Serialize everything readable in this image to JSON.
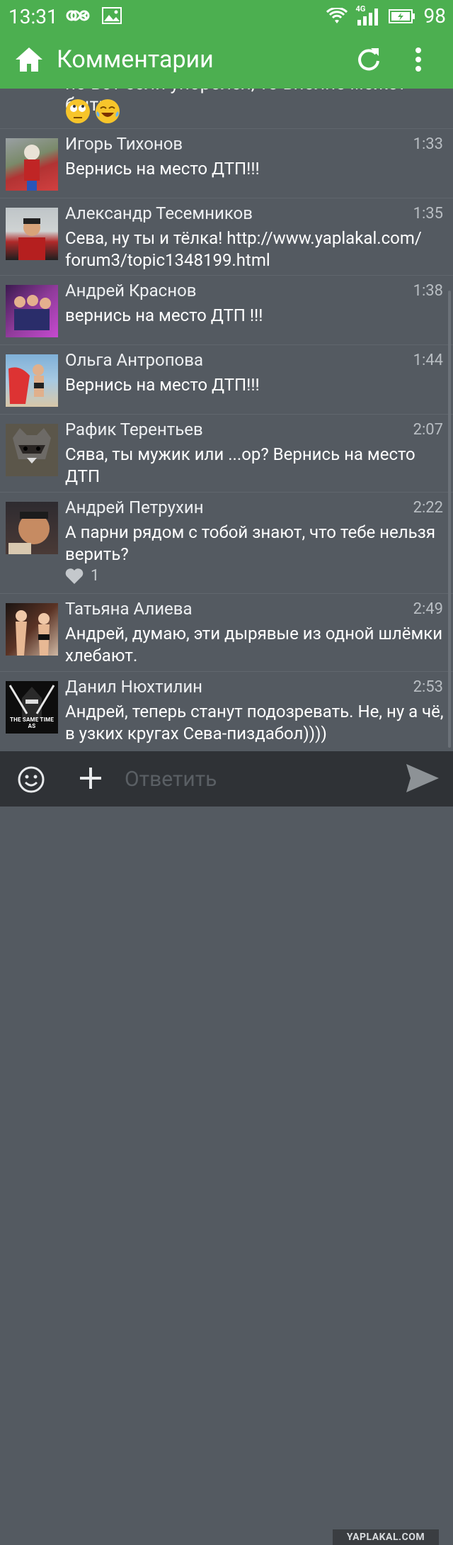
{
  "statusbar": {
    "time": "13:31",
    "signal_label": "4G",
    "battery": "98"
  },
  "appbar": {
    "title": "Комментарии"
  },
  "partial_comment": {
    "text": "но вот если упоролся, то вполне может быть"
  },
  "comments": [
    {
      "author": "Игорь Тихонов",
      "time": "1:33",
      "text": "Вернись на место ДТП!!!",
      "avatar_color": "#7a3b3b"
    },
    {
      "author": "Александр Тесемников",
      "time": "1:35",
      "text": "Сева, ну ты и тёлка! http://www.yaplakal.com/ forum3/topic1348199.html",
      "avatar_color": "#9b2f2f"
    },
    {
      "author": "Андрей Краснов",
      "time": "1:38",
      "text": "вернись на место ДТП !!!",
      "avatar_color": "#6a2f6f"
    },
    {
      "author": "Ольга Антропова",
      "time": "1:44",
      "text": "Вернись на место ДТП!!!",
      "avatar_color": "#c24a4a"
    },
    {
      "author": "Рафик Терентьев",
      "time": "2:07",
      "text": "Сява, ты мужик или ...ор? Вернись на место ДТП",
      "avatar_color": "#5a5448"
    },
    {
      "author": "Андрей Петрухин",
      "time": "2:22",
      "text": "А парни рядом с тобой знают, что тебе нельзя верить?",
      "avatar_color": "#3a3a44",
      "likes": "1"
    },
    {
      "author": "Татьяна Алиева",
      "time": "2:49",
      "text": "Андрей, думаю, эти дырявые из одной шлёмки хлебают.",
      "avatar_color": "#6b3a2e"
    },
    {
      "author": "Данил Нюхтилин",
      "time": "2:53",
      "text": "Андрей, теперь станут подозревать. Не, ну а чё, в узких кругах Сева-пиздабол))))",
      "avatar_color": "#1c1c1c",
      "avatar_caption": "THE SAME TIME AS"
    }
  ],
  "composer": {
    "placeholder": "Ответить"
  },
  "watermark": "YAPLAKAL.COM",
  "colors": {
    "accent": "#4caf50",
    "background": "#545a61",
    "composer": "#2f3236"
  }
}
